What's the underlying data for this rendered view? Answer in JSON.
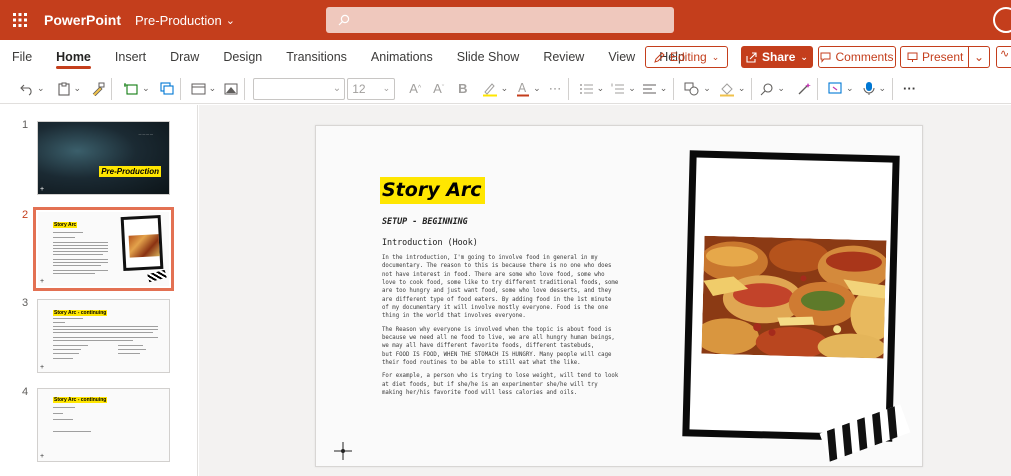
{
  "titlebar": {
    "app_name": "PowerPoint",
    "doc_name": "Pre-Production",
    "doc_chevron": "⌄",
    "bg_color": "#c43e1c"
  },
  "tabs": [
    {
      "label": "File"
    },
    {
      "label": "Home",
      "active": true
    },
    {
      "label": "Insert"
    },
    {
      "label": "Draw"
    },
    {
      "label": "Design"
    },
    {
      "label": "Transitions"
    },
    {
      "label": "Animations"
    },
    {
      "label": "Slide Show"
    },
    {
      "label": "Review"
    },
    {
      "label": "View"
    },
    {
      "label": "Help"
    }
  ],
  "actions": {
    "editing_label": "Editing",
    "share_label": "Share",
    "comments_label": "Comments",
    "present_label": "Present"
  },
  "ribbon": {
    "font_size": "12",
    "icons": [
      "undo-icon",
      "paste-icon",
      "format-painter-icon",
      "new-slide-icon",
      "reuse-slides-icon",
      "layout-icon",
      "picture-icon",
      "increase-font-icon",
      "decrease-font-icon",
      "bold-icon",
      "highlight-icon",
      "font-color-icon",
      "more-icon",
      "bullets-icon",
      "numbering-icon",
      "align-icon",
      "shapes-icon",
      "fill-icon",
      "find-icon",
      "designer-icon",
      "design-ideas-icon",
      "dictate-icon",
      "overflow-icon"
    ]
  },
  "thumbnails": [
    {
      "number": "1",
      "title": "Pre-Production",
      "selected": false
    },
    {
      "number": "2",
      "title": "Story Arc",
      "selected": true
    },
    {
      "number": "3",
      "title": "Story Arc - continuing",
      "selected": false
    },
    {
      "number": "4",
      "title": "Story Arc - continuing",
      "selected": false
    }
  ],
  "slide": {
    "title": "Story Arc",
    "subtitle": "SETUP - BEGINNING",
    "heading": "Introduction (Hook)",
    "paragraphs": [
      "In the introduction, I'm going to involve food in general in my\ndocumentary. The reason to this is because there is no one who does\nnot have interest in food. There are some who love food, some who\nlove to cook food, some like to try different traditional foods, some\nare too hungry and just want food, some who love desserts, and they\nare different type of food eaters. By adding food in the 1st minute\nof my documentary it will involve mostly everyone. Food is the one\nthing in the world that involves everyone.",
      "The Reason why everyone is involved when the topic is about food is\nbecause we need all ne food to live, we are all hungry human beings,\nwe may all have different favorite foods, different tastebuds,\nbut FOOD IS FOOD, WHEN THE STOMACH IS HUNGRY. Many people will cage\ntheir food routines to be able to still eat what the like.",
      "For example, a person who is trying to lose weight, will tend to look\nat diet foods, but if she/he is an experimenter she/he will try\nmaking her/his favorite food will less calories and oils."
    ]
  },
  "colors": {
    "accent": "#c43e1c",
    "highlight_yellow": "#ffe600"
  }
}
